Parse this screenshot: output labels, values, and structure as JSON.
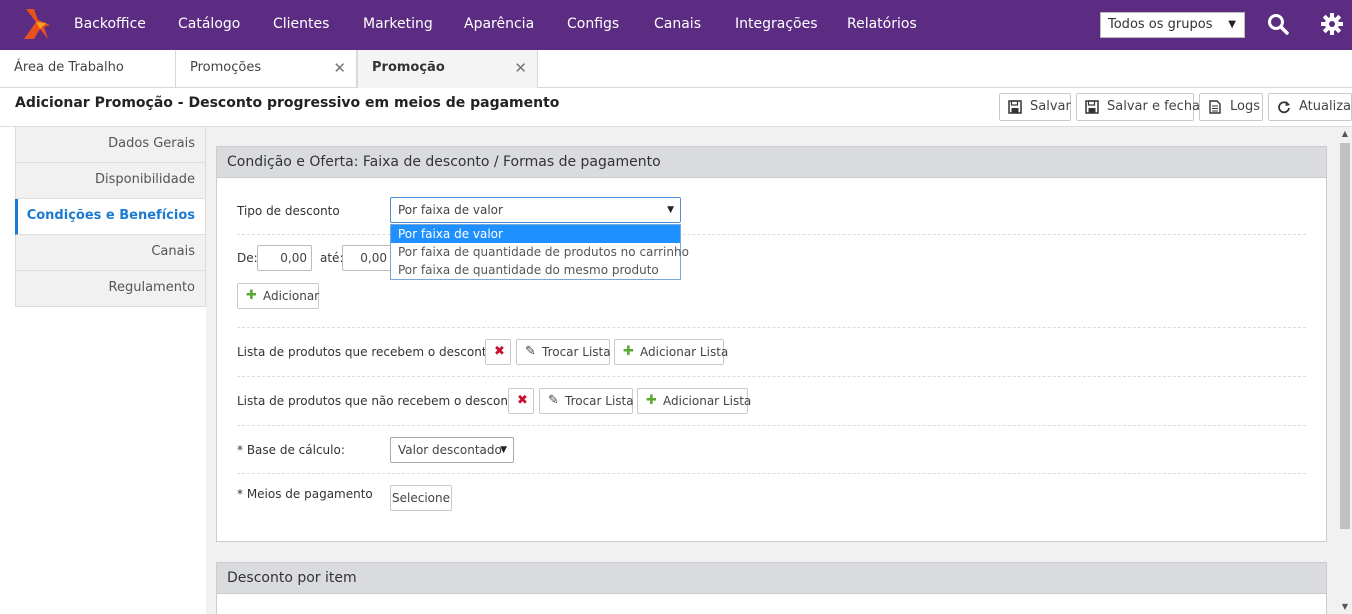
{
  "nav": {
    "items": [
      "Backoffice",
      "Catálogo",
      "Clientes",
      "Marketing",
      "Aparência",
      "Configs",
      "Canais",
      "Integrações",
      "Relatórios"
    ],
    "group_select": "Todos os grupos"
  },
  "tabs": [
    "Área de Trabalho",
    "Promoções",
    "Promoção"
  ],
  "page_title": "Adicionar Promoção - Desconto progressivo em meios de pagamento",
  "actions": {
    "save": "Salvar",
    "save_close": "Salvar e fechar",
    "logs": "Logs",
    "refresh": "Atualizar"
  },
  "sidebar": [
    "Dados Gerais",
    "Disponibilidade",
    "Condições e Benefícios",
    "Canais",
    "Regulamento"
  ],
  "panel": {
    "title": "Condição e Oferta: Faixa de desconto / Formas de pagamento",
    "discount_type_label": "Tipo de desconto",
    "discount_type_value": "Por faixa de valor",
    "discount_type_options": [
      "Por faixa de valor",
      "Por faixa de quantidade de produtos no carrinho",
      "Por faixa de quantidade do mesmo produto"
    ],
    "from_label": "De:",
    "from_value": "0,00",
    "to_label": "até:",
    "to_value": "0,00",
    "add_label": "Adicionar",
    "list_receive_label": "Lista de produtos que recebem o desconto",
    "list_not_receive_label": "Lista de produtos que não recebem o desconto",
    "swap_list": "Trocar Lista",
    "add_list": "Adicionar Lista",
    "base_label": "* Base de cálculo:",
    "base_value": "Valor descontado",
    "payment_label": "* Meios de pagamento",
    "payment_button": "Selecione"
  },
  "panel2": {
    "title": "Desconto por item"
  },
  "colors": {
    "nav_bg": "#5b2c82",
    "accent": "#1a7bd1",
    "selected_option": "#1e90ff"
  }
}
